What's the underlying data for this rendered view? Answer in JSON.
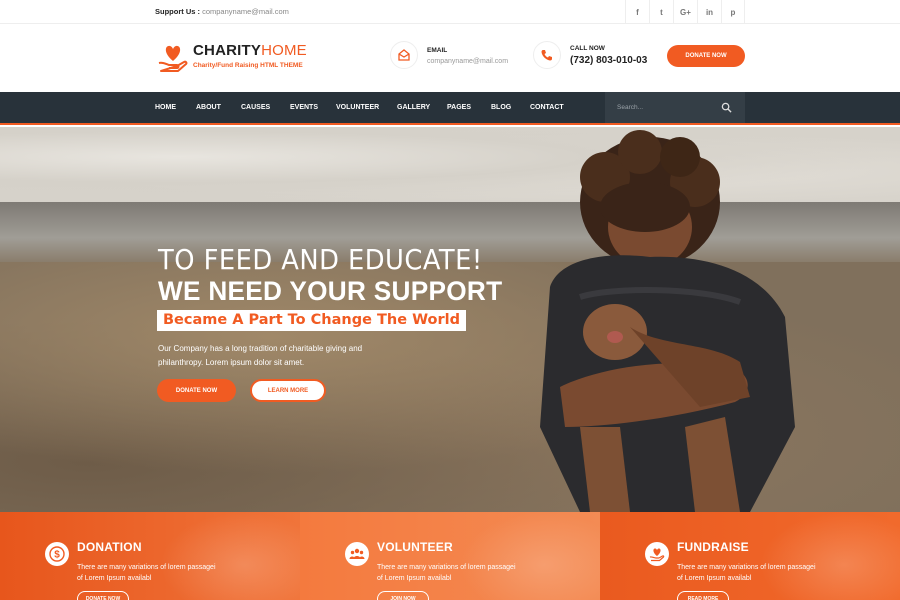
{
  "topbar": {
    "support_label": "Support Us :",
    "support_email": "companyname@mail.com",
    "social_icons": [
      "facebook-icon",
      "twitter-icon",
      "google-plus-icon",
      "linkedin-icon",
      "pinterest-icon"
    ],
    "social_glyphs": [
      "f",
      "t",
      "G+",
      "in",
      "p"
    ]
  },
  "header": {
    "logo_main": "CHARITY",
    "logo_accent": "HOME",
    "logo_sub": "Charity/Fund Raising HTML THEME",
    "email_label": "EMAIL",
    "email_value": "companyname@mail.com",
    "call_label": "CALL NOW",
    "call_value": "(732) 803-010-03",
    "donate_label": "DONATE NOW"
  },
  "nav": {
    "items": [
      "HOME",
      "ABOUT",
      "CAUSES",
      "EVENTS",
      "VOLUNTEER",
      "GALLERY",
      "PAGES",
      "BLOG",
      "CONTACT"
    ],
    "search_placeholder": "Search..."
  },
  "hero": {
    "line1": "TO FEED AND EDUCATE!",
    "line2": "WE NEED YOUR SUPPORT",
    "tagline": "Became A Part To Change The World",
    "desc": "Our Company has a long tradition of charitable giving and philanthropy. Lorem ipsum dolor sit amet.",
    "donate_label": "DONATE NOW",
    "learn_label": "LEARN MORE"
  },
  "features": [
    {
      "title": "DONATION",
      "text": "There are many variations of lorem passagei of Lorem Ipsum availabl",
      "button": "DONATE NOW",
      "icon": "dollar-icon"
    },
    {
      "title": "VOLUNTEER",
      "text": "There are many variations of lorem passagei of Lorem Ipsum availabl",
      "button": "JOIN NOW",
      "icon": "group-icon"
    },
    {
      "title": "FUNDRAISE",
      "text": "There are many variations of lorem passagei of Lorem Ipsum availabl",
      "button": "READ MORE",
      "icon": "heart-hand-icon"
    }
  ],
  "colors": {
    "accent": "#f15b22",
    "nav_bg": "#28323a",
    "search_bg": "#343e46"
  }
}
